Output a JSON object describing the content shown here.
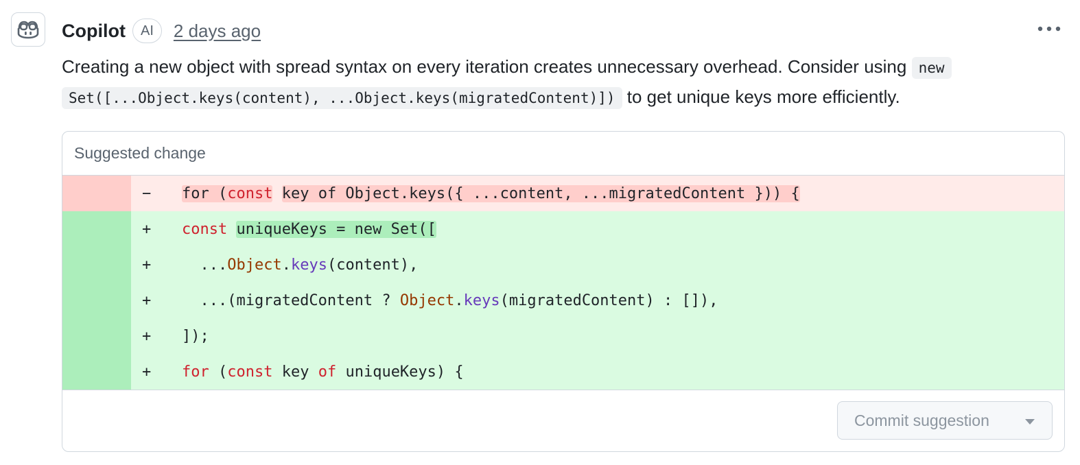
{
  "comment": {
    "author": "Copilot",
    "badge": "AI",
    "timestamp": "2 days ago",
    "avatar_icon": "copilot-icon",
    "menu_icon": "kebab-horizontal-icon",
    "body_prefix": "Creating a new object with spread syntax on every iteration creates unnecessary overhead. Consider using",
    "body_code": "new Set([...Object.keys(content), ...Object.keys(migratedContent)])",
    "body_suffix": "to get unique keys more efficiently."
  },
  "suggestion": {
    "title": "Suggested change",
    "deleted": {
      "sign": "−",
      "tokens": [
        "for (",
        "const",
        " ",
        "key of Object.keys({ ...content, ...migratedContent })) {"
      ]
    },
    "added": [
      {
        "sign": "+",
        "tokens": [
          "const",
          " ",
          "uniqueKeys = new Set(["
        ]
      },
      {
        "sign": "+",
        "tokens": [
          "  ...",
          "Object",
          ".",
          "keys",
          "(content),"
        ]
      },
      {
        "sign": "+",
        "tokens": [
          "  ...(migratedContent ? ",
          "Object",
          ".",
          "keys",
          "(migratedContent) : []),"
        ]
      },
      {
        "sign": "+",
        "tokens": [
          "]);"
        ]
      },
      {
        "sign": "+",
        "tokens": [
          "for",
          " (",
          "const",
          " key ",
          "of",
          " uniqueKeys) {"
        ]
      }
    ],
    "commit_label": "Commit suggestion",
    "commit_caret_icon": "triangle-down-icon"
  },
  "colors": {
    "deleted_bg": "#ffebe9",
    "deleted_gutter": "#ffcecb",
    "added_bg": "#dafbe1",
    "added_gutter": "#aceebb",
    "keyword": "#cf222e",
    "class_name": "#953800",
    "function_name": "#6639ba"
  }
}
